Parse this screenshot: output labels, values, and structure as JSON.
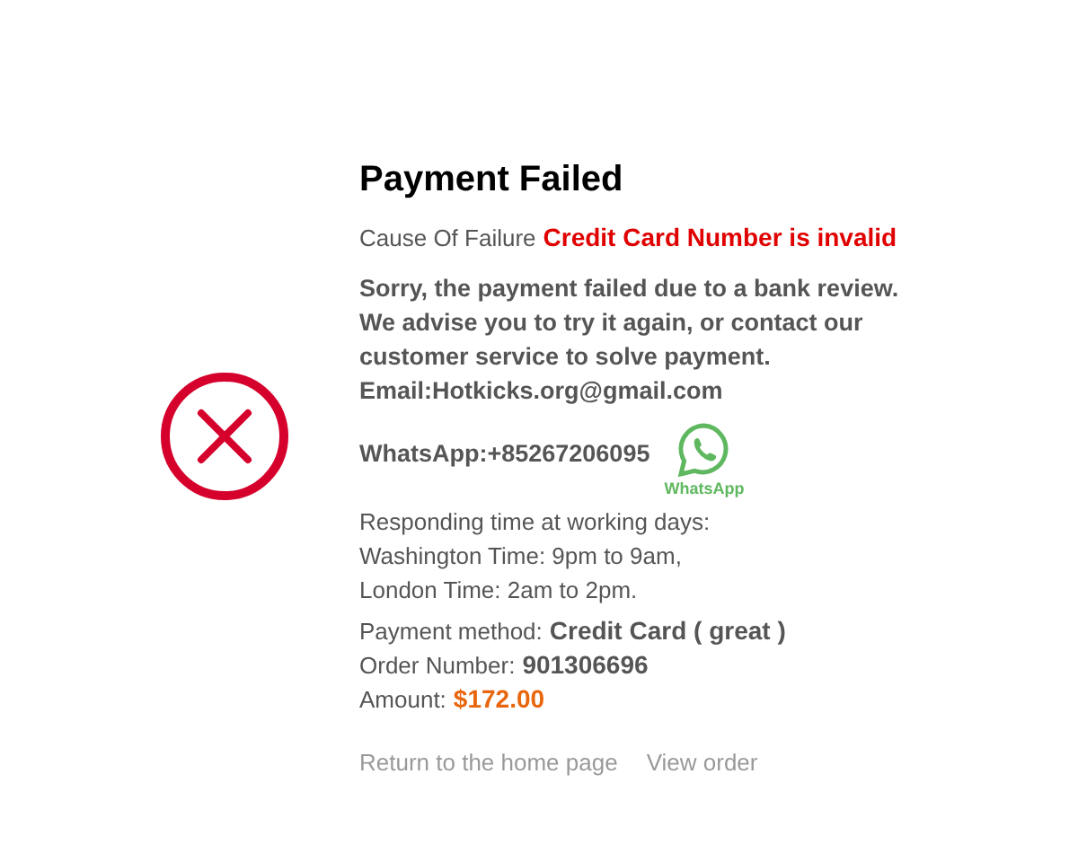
{
  "title": "Payment Failed",
  "cause": {
    "label": "Cause Of Failure",
    "value": "Credit Card Number is invalid"
  },
  "message": [
    "Sorry, the payment failed due to a bank review.",
    "We advise you to try it again, or contact our customer service to solve payment."
  ],
  "email": "Email:Hotkicks.org@gmail.com",
  "whatsapp": {
    "number": "WhatsApp:+85267206095",
    "logo_caption": "WhatsApp"
  },
  "responding_times": [
    "Responding time at working days:",
    "Washington Time: 9pm to 9am,",
    "London Time: 2am to 2pm."
  ],
  "details": [
    {
      "label": "Payment method:",
      "value": "Credit Card ( great )",
      "kind": "plain"
    },
    {
      "label": "Order Number:",
      "value": "901306696",
      "kind": "plain"
    },
    {
      "label": "Amount:",
      "value": "$172.00",
      "kind": "amount"
    }
  ],
  "links": [
    "Return to the home page",
    "View order"
  ]
}
